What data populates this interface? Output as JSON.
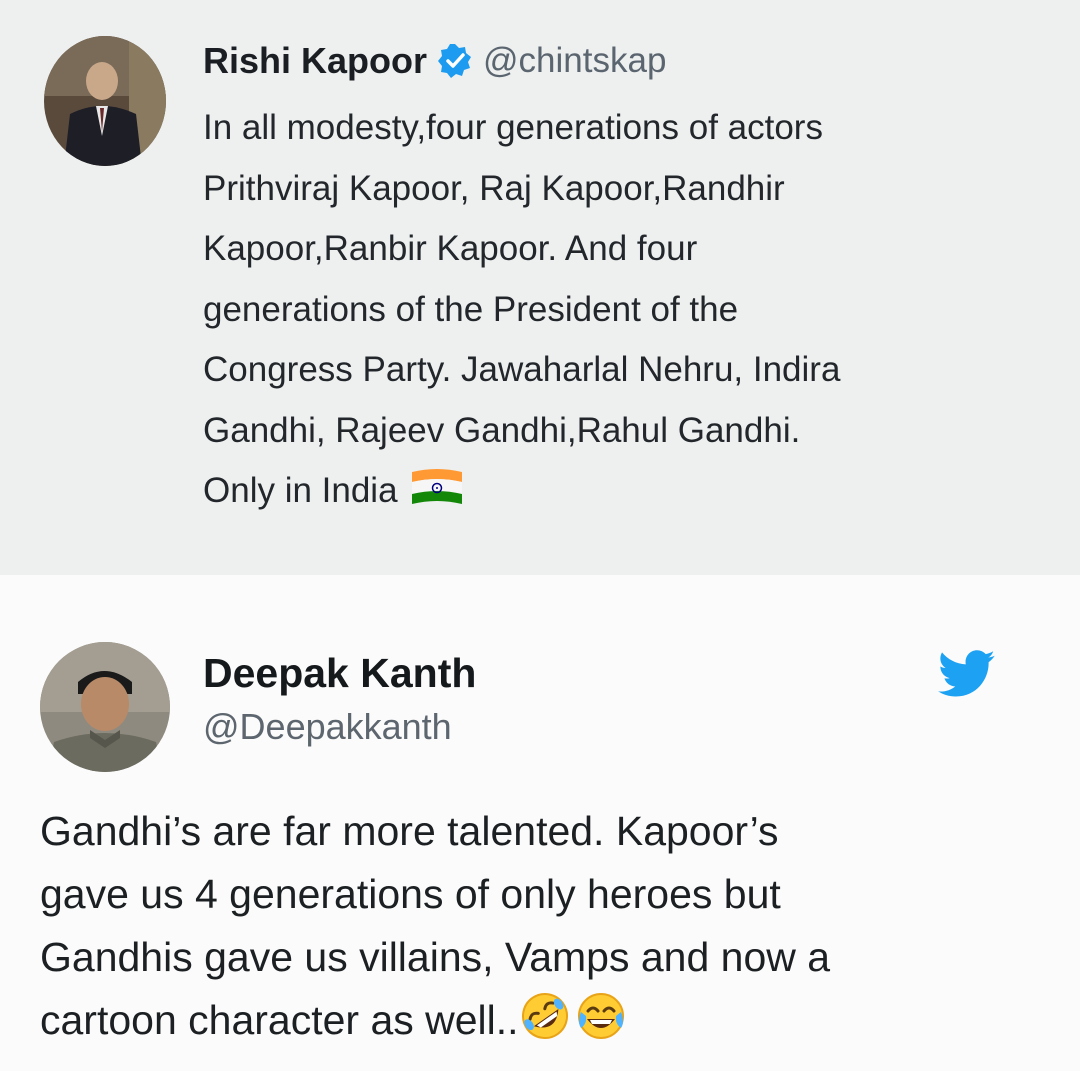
{
  "tweet_1": {
    "display_name": "Rishi Kapoor",
    "handle": "@chintskap",
    "verified": true,
    "text_lines": [
      "In all modesty,four generations of actors",
      "Prithviraj Kapoor, Raj Kapoor,Randhir",
      "Kapoor,Ranbir Kapoor. And four",
      "generations of the President of the",
      "Congress Party. Jawaharlal Nehru, Indira",
      "Gandhi, Rajeev Gandhi,Rahul Gandhi.",
      "Only in India"
    ],
    "trailing_emoji": "indian-flag-emoji",
    "background_color": "#eef0f0"
  },
  "tweet_2": {
    "display_name": "Deepak Kanth",
    "handle": "@Deepakkanth",
    "platform_icon": "twitter-bird-icon",
    "text_lines": [
      "Gandhi’s are far more talented. Kapoor’s",
      "gave us 4 generations of only heroes but",
      "Gandhis gave us villains, Vamps and now a",
      "cartoon character as well.."
    ],
    "trailing_emojis": [
      "rolling-on-floor-laughing-emoji",
      "tears-of-joy-emoji"
    ],
    "background_color": "#fbfbfb"
  },
  "colors": {
    "twitter_blue": "#1da1f2",
    "verified_blue": "#1d9bf0",
    "handle_gray": "#5b6570"
  }
}
